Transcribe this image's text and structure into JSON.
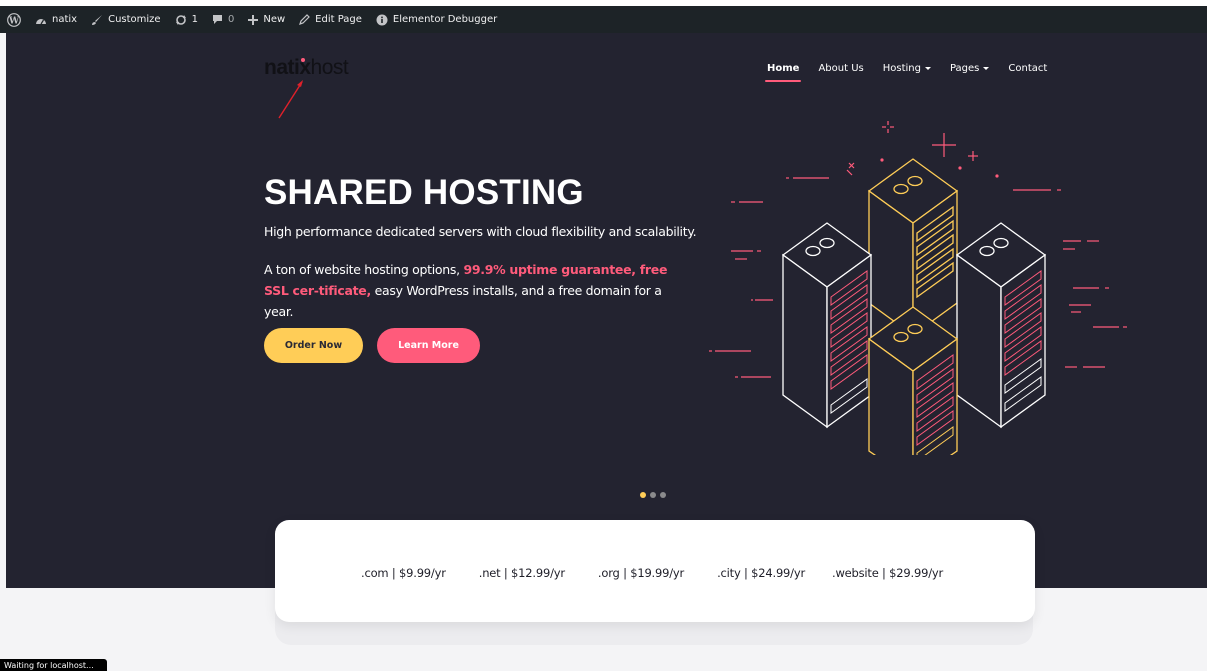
{
  "admin_bar": {
    "site_name": "natix",
    "customize": "Customize",
    "updates": "1",
    "comments": "0",
    "new": "New",
    "edit_page": "Edit Page",
    "debugger": "Elementor Debugger"
  },
  "logo": {
    "bold": "natix",
    "light": "host"
  },
  "nav": {
    "items": [
      {
        "label": "Home",
        "active": true
      },
      {
        "label": "About Us"
      },
      {
        "label": "Hosting"
      },
      {
        "label": "Pages"
      },
      {
        "label": "Contact"
      }
    ]
  },
  "hero": {
    "title": "SHARED HOSTING",
    "subtitle": "High performance dedicated servers with cloud flexibility and scalability.",
    "desc_part1": "A ton of website hosting options, ",
    "desc_highlight": "99.9% uptime guarantee, free SSL cer-tificate,",
    "desc_part2": " easy WordPress installs, and a free domain for a year.",
    "order_btn": "Order Now",
    "learn_btn": "Learn More"
  },
  "domains": [
    ".com | $9.99/yr",
    ".net | $12.99/yr",
    ".org | $19.99/yr",
    ".city | $24.99/yr",
    ".website | $29.99/yr"
  ],
  "status_bar": "Waiting for localhost...",
  "colors": {
    "accent_pink": "#ff5b7b",
    "accent_yellow": "#ffcd57",
    "hero_bg": "#232330",
    "admin_bg": "#1d2327"
  }
}
